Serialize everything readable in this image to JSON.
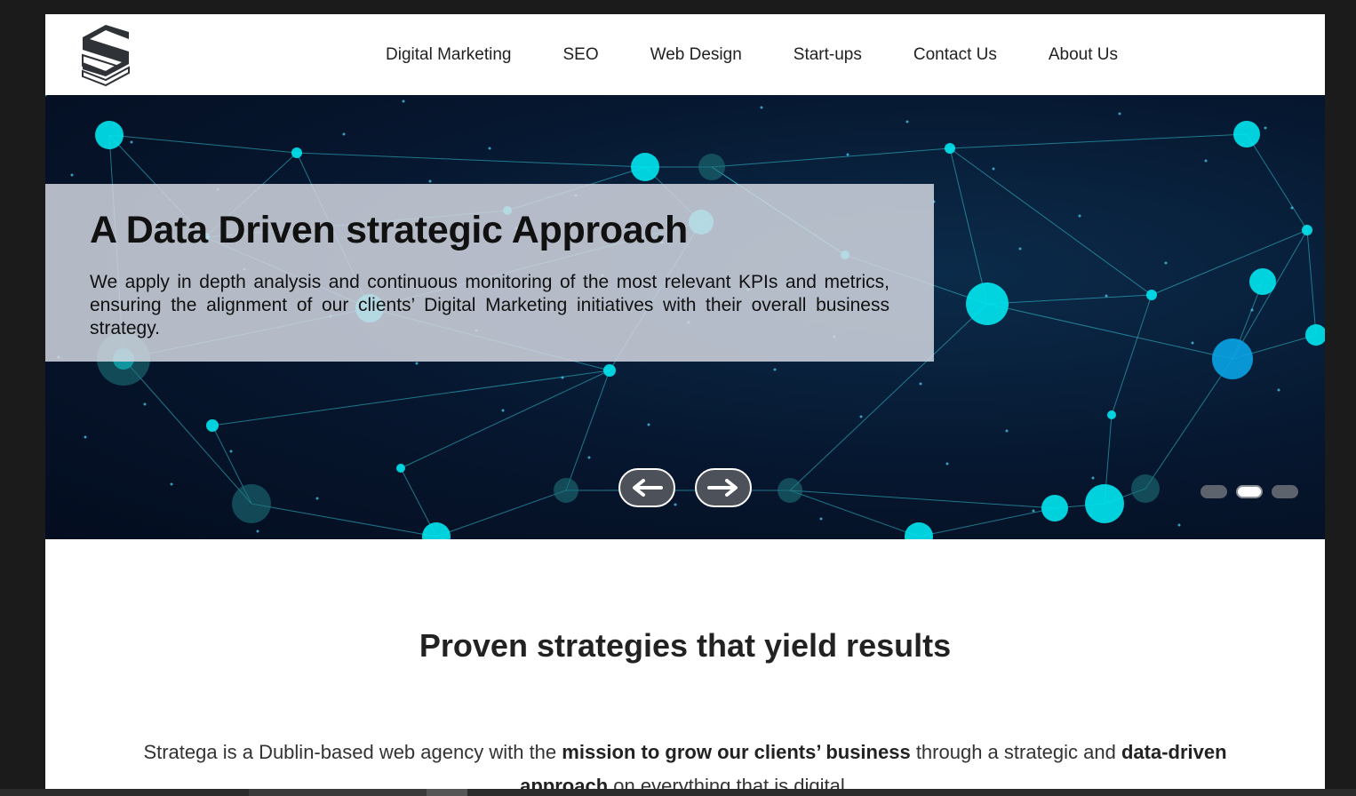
{
  "brand": {
    "logo_icon": "stratega-s-logo-icon"
  },
  "nav": {
    "items": [
      {
        "label": "Digital Marketing"
      },
      {
        "label": "SEO"
      },
      {
        "label": "Web Design"
      },
      {
        "label": "Start-ups"
      },
      {
        "label": "Contact Us"
      },
      {
        "label": "About Us"
      }
    ]
  },
  "hero": {
    "title": "A Data Driven strategic Approach",
    "text": "We apply in depth analysis and continuous monitoring of the most relevant KPIs and metrics, ensuring the alignment of our clients’ Digital Marketing initiatives with their overall business strategy.",
    "prev_icon": "arrow-left-icon",
    "next_icon": "arrow-right-icon",
    "slides": {
      "count": 3,
      "active_index": 1
    }
  },
  "section": {
    "title": "Proven strategies that yield results",
    "intro_parts": [
      "Stratega is a Dublin-based web agency with the ",
      "mission to grow our clients’ business",
      " through a strategic and ",
      "data-driven approach",
      " on everything that is digital."
    ]
  },
  "colors": {
    "accent_cyan": "#00e5f0",
    "hero_bg": "#06162e",
    "overlay": "#d7dae4"
  }
}
